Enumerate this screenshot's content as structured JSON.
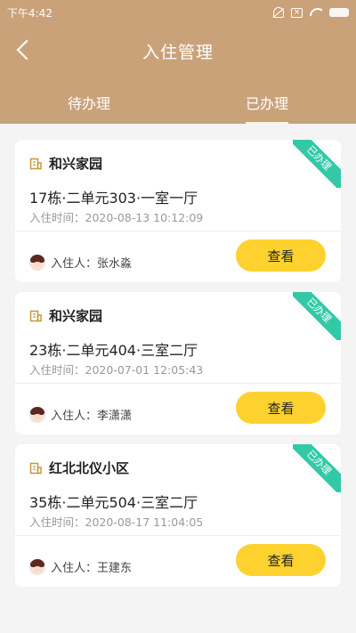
{
  "status_bar": {
    "time": "下午4:42"
  },
  "header": {
    "title": "入住管理"
  },
  "tabs": [
    {
      "label": "待办理",
      "active": false
    },
    {
      "label": "已办理",
      "active": true
    }
  ],
  "colors": {
    "header_bg": "#caa27a",
    "button_bg": "#fdd22e",
    "ribbon_bg": "#33c9a6"
  },
  "cards": [
    {
      "community": "和兴家园",
      "room": "17栋·二单元303·一室一厅",
      "checkin": "入住时间：2020-08-13 10:12:09",
      "resident": "入住人：张水淼",
      "badge": "已办理",
      "button": "查看"
    },
    {
      "community": "和兴家园",
      "room": "23栋·二单元404·三室二厅",
      "checkin": "入住时间：2020-07-01 12:05:43",
      "resident": "入住人：李潇潇",
      "badge": "已办理",
      "button": "查看"
    },
    {
      "community": "红北北仪小区",
      "room": "35栋·二单元504·三室二厅",
      "checkin": "入住时间：2020-08-17 11:04:05",
      "resident": "入住人：王建东",
      "badge": "已办理",
      "button": "查看"
    }
  ]
}
